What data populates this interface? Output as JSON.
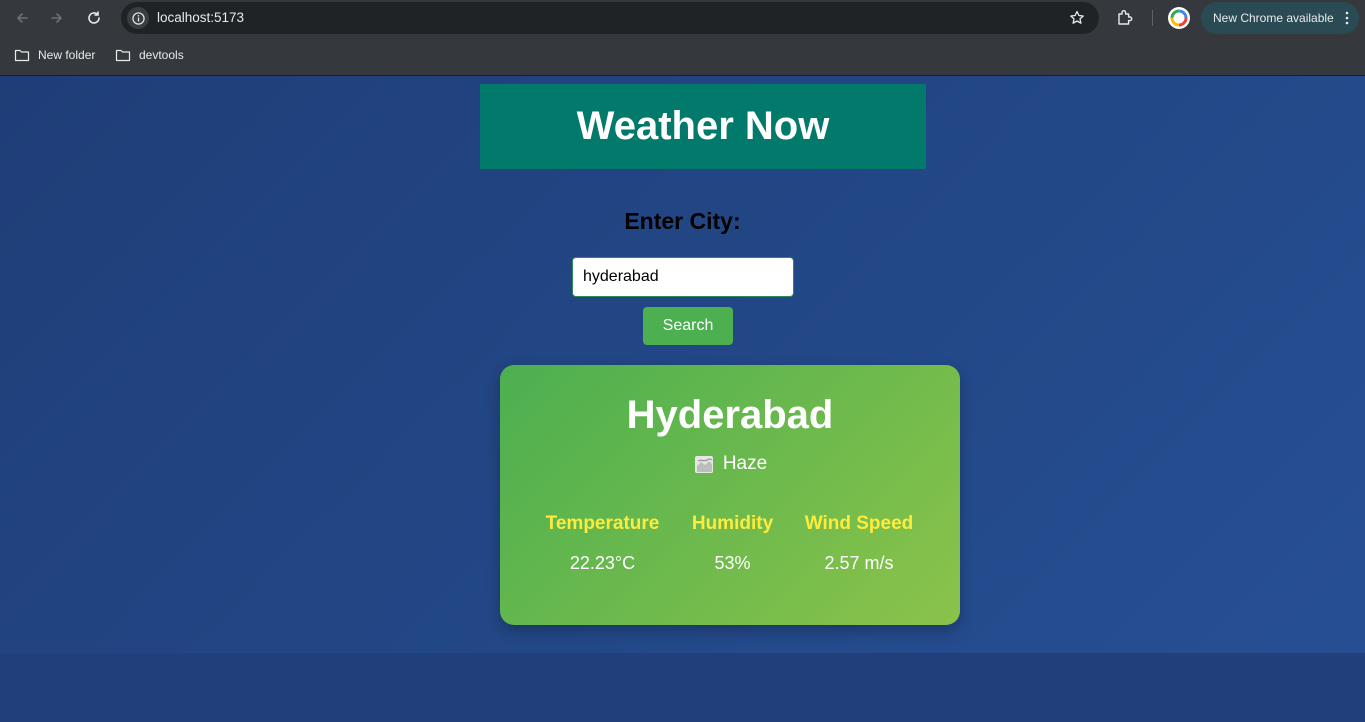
{
  "browser": {
    "url": "localhost:5173",
    "update_label": "New Chrome available",
    "bookmarks": [
      {
        "label": "New folder",
        "icon": "folder-icon"
      },
      {
        "label": "devtools",
        "icon": "folder-icon"
      }
    ]
  },
  "app": {
    "title": "Weather Now",
    "input_label": "Enter City:",
    "search_value": "hyderabad",
    "search_button": "Search"
  },
  "weather": {
    "city": "Hyderabad",
    "condition": "Haze",
    "condition_icon": "haze-icon",
    "stats": [
      {
        "label": "Temperature",
        "value": "22.23°C"
      },
      {
        "label": "Humidity",
        "value": "53%"
      },
      {
        "label": "Wind Speed",
        "value": "2.57 m/s"
      }
    ]
  },
  "colors": {
    "page_background": "#1f3e78",
    "header_banner": "#027a6b",
    "search_button": "#4caf50",
    "card_gradient_start": "#4caf50",
    "card_gradient_end": "#8bc34a",
    "stat_label": "#ffeb3b"
  }
}
